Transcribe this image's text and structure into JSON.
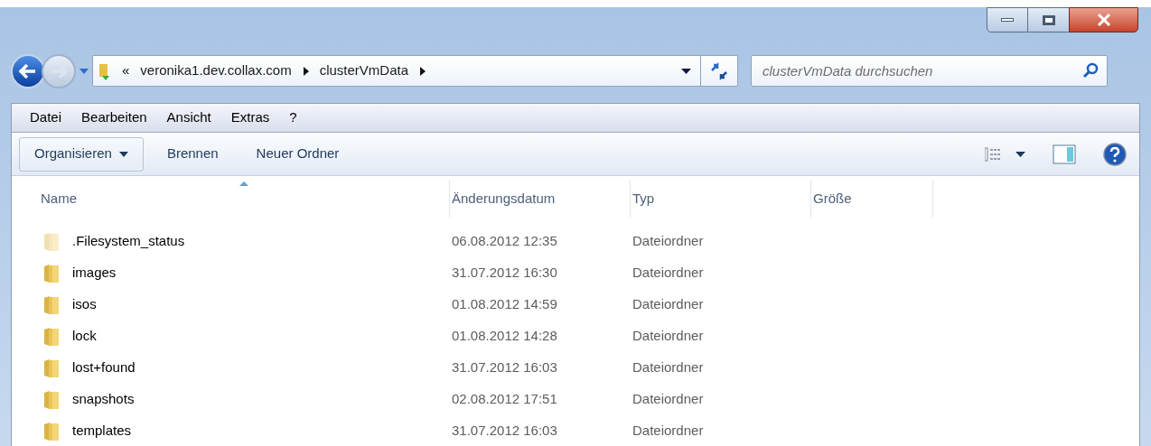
{
  "address": {
    "root_marker": "«",
    "segments": [
      "veronika1.dev.collax.com",
      "clusterVmData"
    ]
  },
  "search": {
    "placeholder": "clusterVmData durchsuchen"
  },
  "menu": [
    "Datei",
    "Bearbeiten",
    "Ansicht",
    "Extras",
    "?"
  ],
  "toolbar": [
    {
      "label": "Organisieren",
      "dropdown": true
    },
    {
      "label": "Brennen",
      "dropdown": false
    },
    {
      "label": "Neuer Ordner",
      "dropdown": false
    }
  ],
  "columns": [
    {
      "label": "Name",
      "sorted": true
    },
    {
      "label": "Änderungsdatum",
      "sorted": false
    },
    {
      "label": "Typ",
      "sorted": false
    },
    {
      "label": "Größe",
      "sorted": false
    }
  ],
  "rows": [
    {
      "name": ".Filesystem_status",
      "date": "06.08.2012 12:35",
      "type": "Dateiordner",
      "hidden": true
    },
    {
      "name": "images",
      "date": "31.07.2012 16:30",
      "type": "Dateiordner",
      "hidden": false
    },
    {
      "name": "isos",
      "date": "01.08.2012 14:59",
      "type": "Dateiordner",
      "hidden": false
    },
    {
      "name": "lock",
      "date": "01.08.2012 14:28",
      "type": "Dateiordner",
      "hidden": false
    },
    {
      "name": "lost+found",
      "date": "31.07.2012 16:03",
      "type": "Dateiordner",
      "hidden": false
    },
    {
      "name": "snapshots",
      "date": "02.08.2012 17:51",
      "type": "Dateiordner",
      "hidden": false
    },
    {
      "name": "templates",
      "date": "31.07.2012 16:03",
      "type": "Dateiordner",
      "hidden": false
    }
  ]
}
